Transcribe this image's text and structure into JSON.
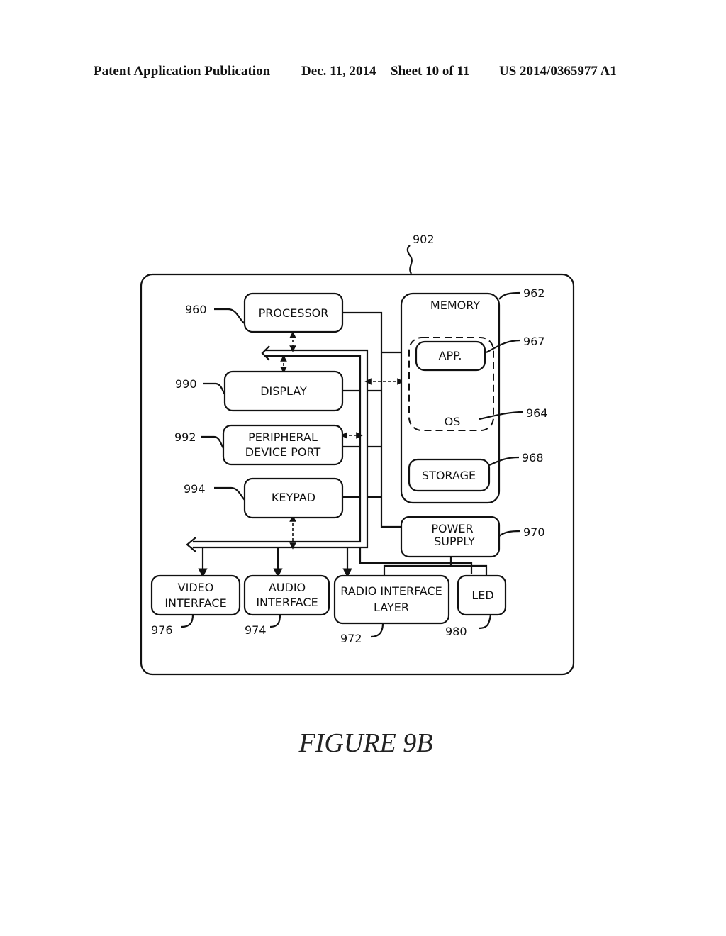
{
  "header": {
    "publication": "Patent Application Publication",
    "date": "Dec. 11, 2014",
    "sheet": "Sheet 10 of 11",
    "number": "US 2014/0365977 A1"
  },
  "figure": {
    "caption": "FIGURE 9B",
    "device_ref": "902",
    "blocks": {
      "processor": {
        "label": "PROCESSOR",
        "ref": "960"
      },
      "display": {
        "label": "DISPLAY",
        "ref": "990"
      },
      "peripheral": {
        "label1": "PERIPHERAL",
        "label2": "DEVICE PORT",
        "ref": "992"
      },
      "keypad": {
        "label": "KEYPAD",
        "ref": "994"
      },
      "memory": {
        "label": "MEMORY",
        "ref": "962"
      },
      "app": {
        "label": "APP.",
        "ref": "967"
      },
      "os": {
        "label": "OS",
        "ref": "964"
      },
      "storage": {
        "label": "STORAGE",
        "ref": "968"
      },
      "power": {
        "label1": "POWER",
        "label2": "SUPPLY",
        "ref": "970"
      },
      "video": {
        "label1": "VIDEO",
        "label2": "INTERFACE",
        "ref": "976"
      },
      "audio": {
        "label1": "AUDIO",
        "label2": "INTERFACE",
        "ref": "974"
      },
      "radio": {
        "label1": "RADIO INTERFACE",
        "label2": "LAYER",
        "ref": "972"
      },
      "led": {
        "label": "LED",
        "ref": "980"
      }
    }
  }
}
